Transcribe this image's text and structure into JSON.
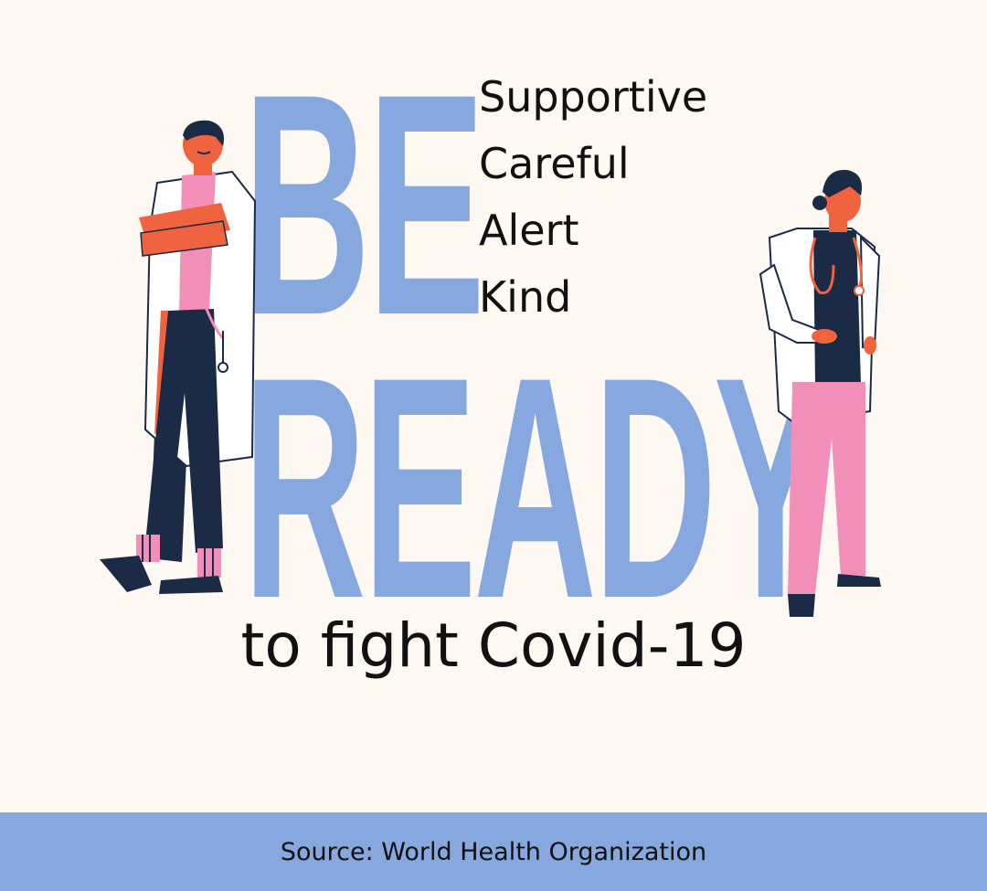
{
  "headline": {
    "line1": "BE",
    "line2": "READY"
  },
  "qualities": [
    "Supportive",
    "Careful",
    "Alert",
    "Kind"
  ],
  "tagline": "to fight Covid-19",
  "footer": {
    "source": "Source: World Health Organization"
  },
  "colors": {
    "background": "#FDF8F1",
    "accent_blue": "#86A8DF",
    "text": "#111111",
    "pink": "#F28FB8",
    "navy": "#1B2A45",
    "skin": "#F0633F"
  },
  "illustrations": [
    "male-doctor-illustration",
    "female-doctor-illustration"
  ]
}
